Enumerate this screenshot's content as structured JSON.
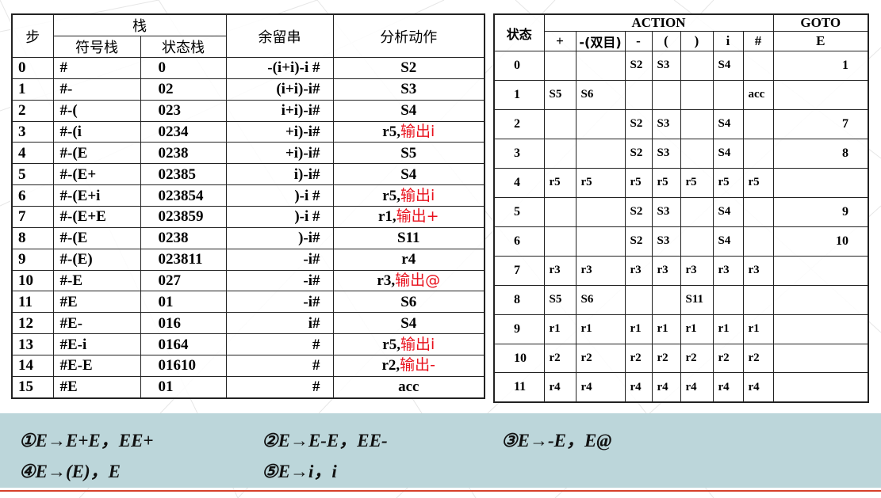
{
  "trace": {
    "headers": {
      "step": "步",
      "stack": "栈",
      "symbol_stack": "符号栈",
      "state_stack": "状态栈",
      "remaining": "余留串",
      "action": "分析动作"
    },
    "rows": [
      {
        "step": "0",
        "sym": "#",
        "state": "0",
        "rem": "-(i+i)-i #",
        "act": "S2",
        "out": ""
      },
      {
        "step": "1",
        "sym": "#-",
        "state": "02",
        "rem": "(i+i)-i#",
        "act": "S3",
        "out": ""
      },
      {
        "step": "2",
        "sym": "#-(",
        "state": "023",
        "rem": "i+i)-i#",
        "act": "S4",
        "out": ""
      },
      {
        "step": "3",
        "sym": "#-(i",
        "state": "0234",
        "rem": "+i)-i#",
        "act": "r5,",
        "out": "输出i"
      },
      {
        "step": "4",
        "sym": "#-(E",
        "state": "0238",
        "rem": "+i)-i#",
        "act": "S5",
        "out": ""
      },
      {
        "step": "5",
        "sym": "#-(E+",
        "state": "02385",
        "rem": "i)-i#",
        "act": "S4",
        "out": ""
      },
      {
        "step": "6",
        "sym": "#-(E+i",
        "state": "023854",
        "rem": ")-i #",
        "act": "r5,",
        "out": "输出i"
      },
      {
        "step": "7",
        "sym": "#-(E+E",
        "state": "023859",
        "rem": ")-i #",
        "act": "r1,",
        "out": "输出+"
      },
      {
        "step": "8",
        "sym": "#-(E",
        "state": "0238",
        "rem": ")-i#",
        "act": "S11",
        "out": ""
      },
      {
        "step": "9",
        "sym": "#-(E)",
        "state": "023811",
        "rem": "-i#",
        "act": "r4",
        "out": ""
      },
      {
        "step": "10",
        "sym": "#-E",
        "state": "027",
        "rem": "-i#",
        "act": "r3,",
        "out": "输出@"
      },
      {
        "step": "11",
        "sym": "#E",
        "state": "01",
        "rem": "-i#",
        "act": "S6",
        "out": ""
      },
      {
        "step": "12",
        "sym": "#E-",
        "state": "016",
        "rem": "i#",
        "act": "S4",
        "out": ""
      },
      {
        "step": "13",
        "sym": "#E-i",
        "state": "0164",
        "rem": "#",
        "act": "r5,",
        "out": "输出i"
      },
      {
        "step": "14",
        "sym": "#E-E",
        "state": "01610",
        "rem": "#",
        "act": "r2,",
        "out": "输出-"
      },
      {
        "step": "15",
        "sym": "#E",
        "state": "01",
        "rem": "#",
        "act": "acc",
        "out": ""
      }
    ]
  },
  "ptable": {
    "headers": {
      "state": "状态",
      "action": "ACTION",
      "goto": "GOTO"
    },
    "terminals": [
      "+",
      "-(双目)",
      "-",
      "(",
      ")",
      "i",
      "#"
    ],
    "nonterminals": [
      "E"
    ],
    "rows": [
      {
        "state": "0",
        "cells": [
          "",
          "",
          "S2",
          "S3",
          "",
          "S4",
          ""
        ],
        "goto": "1"
      },
      {
        "state": "1",
        "cells": [
          "S5",
          "S6",
          "",
          "",
          "",
          "",
          "acc"
        ],
        "goto": ""
      },
      {
        "state": "2",
        "cells": [
          "",
          "",
          "S2",
          "S3",
          "",
          "S4",
          ""
        ],
        "goto": "7"
      },
      {
        "state": "3",
        "cells": [
          "",
          "",
          "S2",
          "S3",
          "",
          "S4",
          ""
        ],
        "goto": "8"
      },
      {
        "state": "4",
        "cells": [
          "r5",
          "r5",
          "r5",
          "r5",
          "r5",
          "r5",
          "r5"
        ],
        "goto": ""
      },
      {
        "state": "5",
        "cells": [
          "",
          "",
          "S2",
          "S3",
          "",
          "S4",
          ""
        ],
        "goto": "9"
      },
      {
        "state": "6",
        "cells": [
          "",
          "",
          "S2",
          "S3",
          "",
          "S4",
          ""
        ],
        "goto": "10"
      },
      {
        "state": "7",
        "cells": [
          "r3",
          "r3",
          "r3",
          "r3",
          "r3",
          "r3",
          "r3"
        ],
        "goto": ""
      },
      {
        "state": "8",
        "cells": [
          "S5",
          "S6",
          "",
          "",
          "S11",
          "",
          ""
        ],
        "goto": ""
      },
      {
        "state": "9",
        "cells": [
          "r1",
          "r1",
          "r1",
          "r1",
          "r1",
          "r1",
          "r1"
        ],
        "goto": ""
      },
      {
        "state": "10",
        "cells": [
          "r2",
          "r2",
          "r2",
          "r2",
          "r2",
          "r2",
          "r2"
        ],
        "goto": ""
      },
      {
        "state": "11",
        "cells": [
          "r4",
          "r4",
          "r4",
          "r4",
          "r4",
          "r4",
          "r4"
        ],
        "goto": ""
      }
    ]
  },
  "grammar": {
    "rule1": "①E→E+E，EE+",
    "rule2": "②E→E-E，EE-",
    "rule3": "③E→-E，E@",
    "rule4": "④E→(E)，E",
    "rule5": "⑤E→i，i"
  },
  "colors": {
    "output_red": "#e8101c",
    "grammar_bg": "#bcd6da",
    "accent_line": "#d6402a"
  }
}
